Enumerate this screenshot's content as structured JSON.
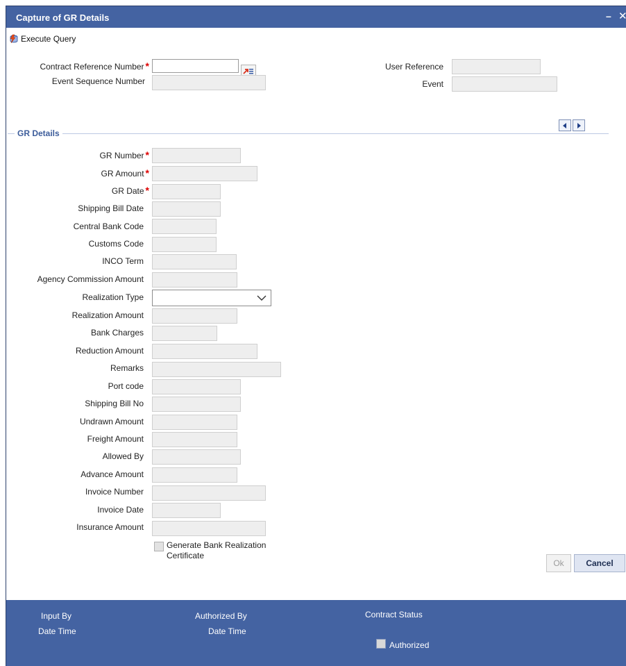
{
  "window": {
    "title": "Capture of GR Details",
    "minimize_glyph": "–",
    "close_glyph": "✕"
  },
  "toolbar": {
    "execute_query_label": "Execute Query",
    "execute_query_icon": "execute-query-icon"
  },
  "header": {
    "contract_reference_label": "Contract Reference Number",
    "contract_reference_value": "",
    "event_sequence_label": "Event Sequence Number",
    "event_sequence_value": "",
    "user_reference_label": "User Reference",
    "user_reference_value": "",
    "event_label": "Event",
    "event_value": ""
  },
  "section": {
    "title": "GR Details"
  },
  "fields": [
    {
      "key": "gr_number",
      "label": "GR Number",
      "required": true,
      "value": ""
    },
    {
      "key": "gr_amount",
      "label": "GR Amount",
      "required": true,
      "value": ""
    },
    {
      "key": "gr_date",
      "label": "GR Date",
      "required": true,
      "value": ""
    },
    {
      "key": "shipping_bill_date",
      "label": "Shipping Bill Date",
      "required": false,
      "value": ""
    },
    {
      "key": "central_bank_code",
      "label": "Central Bank Code",
      "required": false,
      "value": ""
    },
    {
      "key": "customs_code",
      "label": "Customs Code",
      "required": false,
      "value": ""
    },
    {
      "key": "inco_term",
      "label": "INCO Term",
      "required": false,
      "value": ""
    },
    {
      "key": "agency_commission_amount",
      "label": "Agency Commission Amount",
      "required": false,
      "value": ""
    },
    {
      "key": "realization_type",
      "label": "Realization Type",
      "required": false,
      "value": ""
    },
    {
      "key": "realization_amount",
      "label": "Realization Amount",
      "required": false,
      "value": ""
    },
    {
      "key": "bank_charges",
      "label": "Bank Charges",
      "required": false,
      "value": ""
    },
    {
      "key": "reduction_amount",
      "label": "Reduction Amount",
      "required": false,
      "value": ""
    },
    {
      "key": "remarks",
      "label": "Remarks",
      "required": false,
      "value": ""
    },
    {
      "key": "port_code",
      "label": "Port code",
      "required": false,
      "value": ""
    },
    {
      "key": "shipping_bill_no",
      "label": "Shipping Bill No",
      "required": false,
      "value": ""
    },
    {
      "key": "undrawn_amount",
      "label": "Undrawn Amount",
      "required": false,
      "value": ""
    },
    {
      "key": "freight_amount",
      "label": "Freight Amount",
      "required": false,
      "value": ""
    },
    {
      "key": "allowed_by",
      "label": "Allowed By",
      "required": false,
      "value": ""
    },
    {
      "key": "advance_amount",
      "label": "Advance Amount",
      "required": false,
      "value": ""
    },
    {
      "key": "invoice_number",
      "label": "Invoice Number",
      "required": false,
      "value": ""
    },
    {
      "key": "invoice_date",
      "label": "Invoice Date",
      "required": false,
      "value": ""
    },
    {
      "key": "insurance_amount",
      "label": "Insurance Amount",
      "required": false,
      "value": ""
    }
  ],
  "required_marker": "*",
  "generate_brc": {
    "label_line1": "Generate Bank Realization",
    "label_line2": "Certificate",
    "checked": false
  },
  "footer": {
    "input_by_label": "Input By",
    "date_time_label_1": "Date Time",
    "authorized_by_label": "Authorized By",
    "date_time_label_2": "Date Time",
    "contract_status_label": "Contract Status",
    "authorized_label": "Authorized",
    "authorized_checked": false
  },
  "buttons": {
    "ok_label": "Ok",
    "cancel_label": "Cancel"
  },
  "colors": {
    "title_bar": "#4463a2",
    "section_title": "#3d5d9b",
    "required": "#dd0000"
  }
}
